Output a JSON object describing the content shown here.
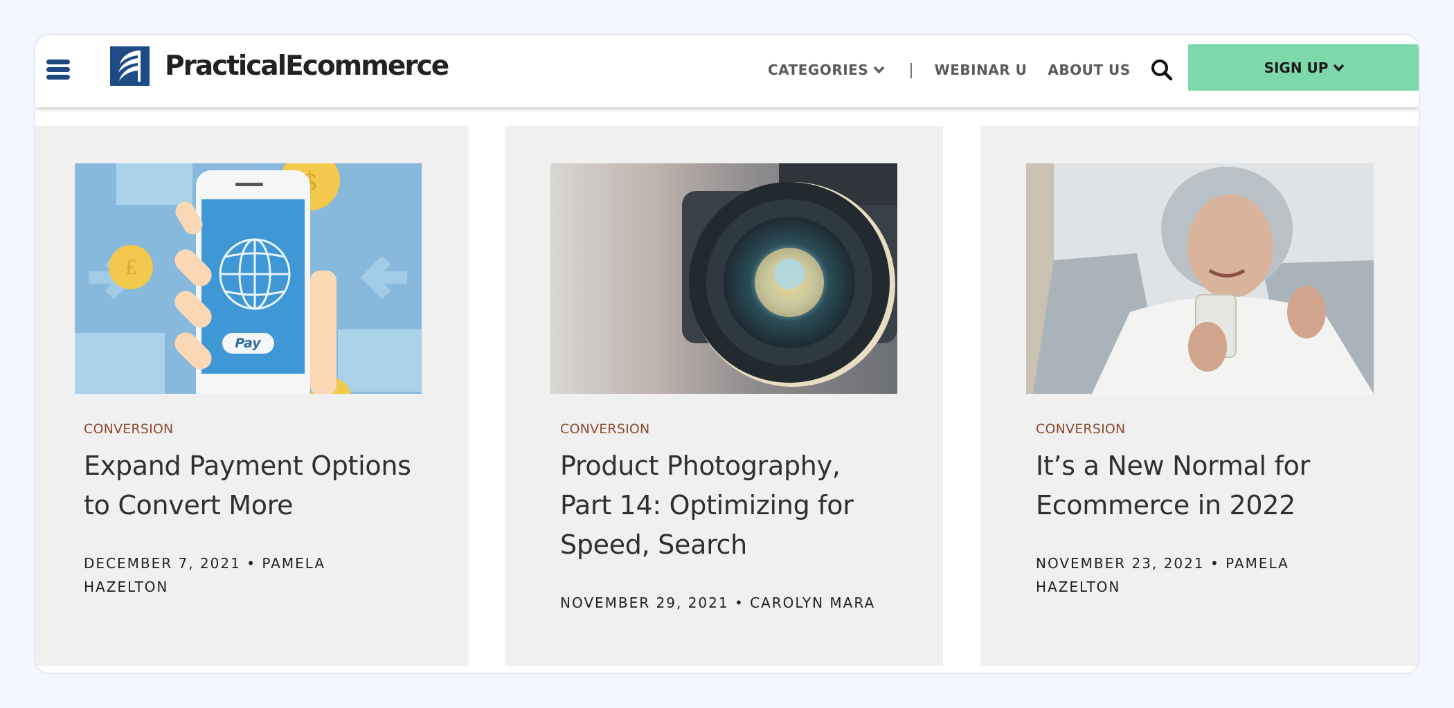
{
  "header": {
    "logo_text": "PracticalEcommerce",
    "menu_icon": "hamburger-menu-icon",
    "nav": {
      "categories": "CATEGORIES",
      "separator": "|",
      "webinar": "WEBINAR U",
      "about": "ABOUT US"
    },
    "search_icon": "search-icon",
    "signup_label": "SIGN UP"
  },
  "colors": {
    "brand_blue": "#1f4a7f",
    "signup_green": "#7dd8aa",
    "category_brown": "#8a4a2e",
    "card_bg": "#f0f0f0",
    "page_bg": "#f3f6fd"
  },
  "articles": [
    {
      "category": "CONVERSION",
      "title": "Expand Payment Options to Convert More",
      "meta": "DECEMBER 7, 2021 • PAMELA HAZELTON",
      "image": "mobile-payment-illustration"
    },
    {
      "category": "CONVERSION",
      "title": "Product Photography, Part 14: Optimizing for Speed, Search",
      "meta": "NOVEMBER 29, 2021 • CAROLYN MARA",
      "image": "camera-lens-photo"
    },
    {
      "category": "CONVERSION",
      "title": "It’s a New Normal for Ecommerce in 2022",
      "meta": "NOVEMBER 23, 2021 • PAMELA HAZELTON",
      "image": "woman-with-smartphone-photo"
    }
  ]
}
